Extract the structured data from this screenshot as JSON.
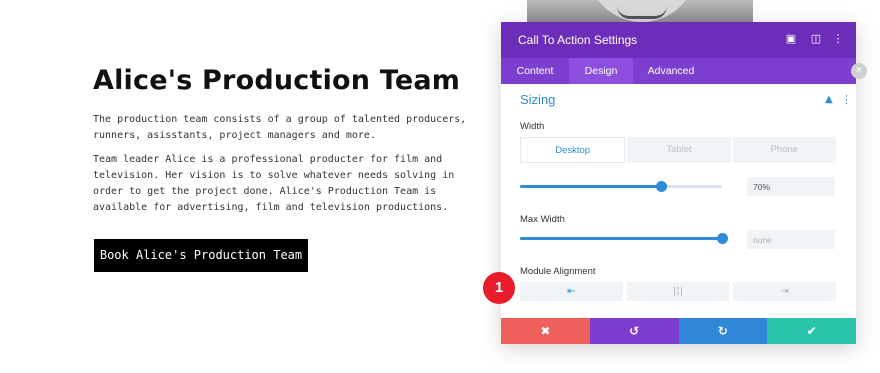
{
  "page": {
    "heading": "Alice's Production Team",
    "paragraph1": "The production team consists of a group of talented producers, runners, asisstants, project managers and more.",
    "paragraph2": "Team leader Alice is a professional producter for film and television. Her vision is to solve whatever needs solving in order to get the project done. Alice's Production Team is available for advertising, film and television productions.",
    "button_label": "Book Alice's Production Team"
  },
  "modal": {
    "title": "Call To Action Settings",
    "header_icons": [
      "expand-icon",
      "columns-icon",
      "more-icon"
    ],
    "tabs": [
      {
        "label": "Content",
        "active": false
      },
      {
        "label": "Design",
        "active": true
      },
      {
        "label": "Advanced",
        "active": false
      }
    ],
    "section": {
      "title": "Sizing",
      "width_label": "Width",
      "devices": [
        {
          "label": "Desktop",
          "active": true
        },
        {
          "label": "Tablet",
          "active": false
        },
        {
          "label": "Phone",
          "active": false
        }
      ],
      "width_value": "70%",
      "width_slider_fraction": 0.7,
      "max_width_label": "Max Width",
      "max_width_placeholder": "none",
      "max_width_slider_fraction": 1.0,
      "module_alignment_label": "Module Alignment",
      "alignment_options": [
        {
          "icon": "align-left-icon",
          "glyph": "⇤",
          "active": true
        },
        {
          "icon": "align-center-icon",
          "glyph": "|¦|",
          "active": false
        },
        {
          "icon": "align-right-icon",
          "glyph": "⇥",
          "active": false
        }
      ]
    },
    "footer": {
      "cancel": "✖",
      "undo": "↺",
      "redo": "↻",
      "save": "✔"
    }
  },
  "badge": "1",
  "colors": {
    "header": "#6c2eb9",
    "tabs": "#7d3fd0",
    "accent": "#2e8bd7",
    "cancel": "#ef5f5c",
    "undo": "#7e3bd0",
    "redo": "#2e87d7",
    "save": "#29c4a9",
    "badge": "#e81c2a"
  }
}
